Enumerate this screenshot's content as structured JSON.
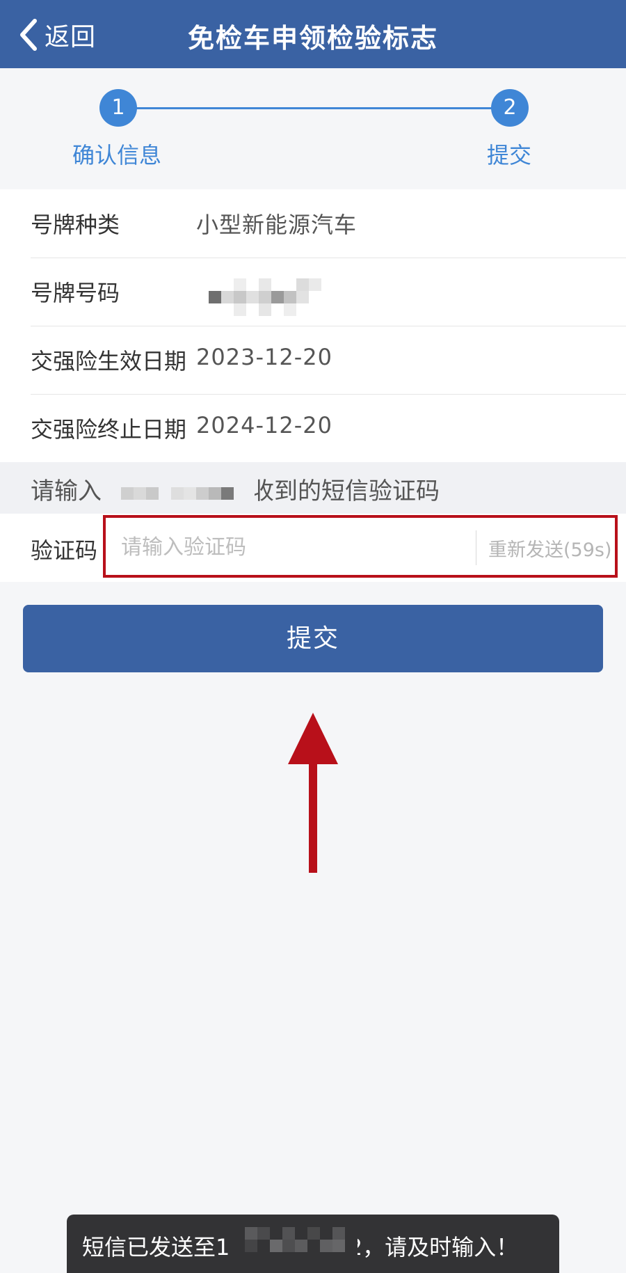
{
  "navbar": {
    "back_label": "返回",
    "title": "免检车申领检验标志"
  },
  "stepper": {
    "steps": [
      {
        "number": "1",
        "label": "确认信息"
      },
      {
        "number": "2",
        "label": "提交"
      }
    ],
    "color": "#3f86d6"
  },
  "info": {
    "rows": [
      {
        "label": "号牌种类",
        "value": "小型新能源汽车"
      },
      {
        "label": "号牌号码",
        "value": ""
      },
      {
        "label": "交强险生效日期",
        "value": "2023-12-20"
      },
      {
        "label": "交强险终止日期",
        "value": "2024-12-20"
      }
    ]
  },
  "sms_hint": {
    "prefix": "请输入",
    "suffix": "收到的短信验证码"
  },
  "verification": {
    "label": "验证码",
    "placeholder": "请输入验证码",
    "resend": "重新发送(59s)",
    "highlight_color": "#b8101a"
  },
  "submit": {
    "label": "提交",
    "color": "#3a62a3"
  },
  "toast": {
    "prefix": "短信已发送至1",
    "suffix": "82，请及时输入！"
  },
  "icons": {
    "back": "chevron-left-icon",
    "annotation": "red-arrow-up-icon"
  }
}
